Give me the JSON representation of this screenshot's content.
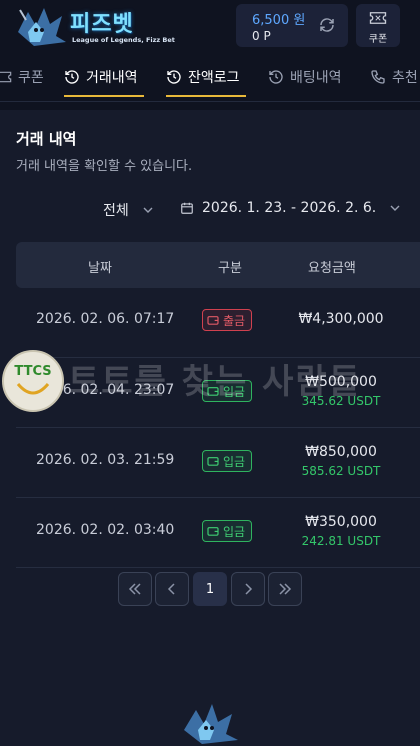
{
  "header": {
    "logo_title": "피즈벳",
    "logo_subtitle": "League of Legends, Fizz Bet",
    "balance_amount": "6,500 원",
    "balance_points": "0 P",
    "coupon_label": "쿠폰"
  },
  "tabs": [
    {
      "label": "쿠폰",
      "icon": "coupon-icon",
      "active": false
    },
    {
      "label": "거래내역",
      "icon": "history-icon",
      "active": true
    },
    {
      "label": "잔액로그",
      "icon": "history-icon",
      "active": true
    },
    {
      "label": "배팅내역",
      "icon": "history-icon",
      "active": false
    },
    {
      "label": "추천",
      "icon": "phone-icon",
      "active": false
    }
  ],
  "section": {
    "title": "거래 내역",
    "subtitle": "거래 내역을 확인할 수 있습니다."
  },
  "filters": {
    "type_selected": "전체",
    "date_range": "2026. 1. 23. - 2026. 2. 6."
  },
  "table": {
    "headers": [
      "날짜",
      "구분",
      "요청금액"
    ],
    "rows": [
      {
        "date": "2026. 02. 06. 07:17",
        "type": "출금",
        "kind": "withdrawal",
        "amount": "₩4,300,000",
        "usdt": ""
      },
      {
        "date": "2026. 02. 04. 23:07",
        "type": "입금",
        "kind": "deposit",
        "amount": "₩500,000",
        "usdt": "345.62 USDT"
      },
      {
        "date": "2026. 02. 03. 21:59",
        "type": "입금",
        "kind": "deposit",
        "amount": "₩850,000",
        "usdt": "585.62 USDT"
      },
      {
        "date": "2026. 02. 02. 03:40",
        "type": "입금",
        "kind": "deposit",
        "amount": "₩350,000",
        "usdt": "242.81 USDT"
      }
    ]
  },
  "pagination": {
    "current_page": "1",
    "buttons": [
      "first-page",
      "prev-page",
      "page-1",
      "next-page",
      "last-page"
    ]
  },
  "watermark": {
    "badge": "TTCS",
    "text": "토토를 찾는 사람들"
  },
  "colors": {
    "background": "#0f1320",
    "panel": "#161b2b",
    "accent_underline": "#e8b93a",
    "balance_blue": "#5ea8ff",
    "withdraw_red": "#d0414f",
    "deposit_green": "#2fb35f"
  }
}
